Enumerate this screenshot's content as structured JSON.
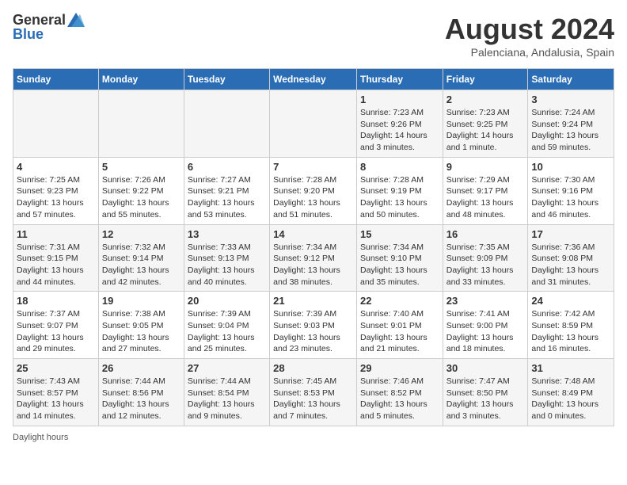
{
  "header": {
    "logo_general": "General",
    "logo_blue": "Blue",
    "month_year": "August 2024",
    "location": "Palenciana, Andalusia, Spain"
  },
  "weekdays": [
    "Sunday",
    "Monday",
    "Tuesday",
    "Wednesday",
    "Thursday",
    "Friday",
    "Saturday"
  ],
  "weeks": [
    [
      {
        "day": "",
        "info": ""
      },
      {
        "day": "",
        "info": ""
      },
      {
        "day": "",
        "info": ""
      },
      {
        "day": "",
        "info": ""
      },
      {
        "day": "1",
        "info": "Sunrise: 7:23 AM\nSunset: 9:26 PM\nDaylight: 14 hours\nand 3 minutes."
      },
      {
        "day": "2",
        "info": "Sunrise: 7:23 AM\nSunset: 9:25 PM\nDaylight: 14 hours\nand 1 minute."
      },
      {
        "day": "3",
        "info": "Sunrise: 7:24 AM\nSunset: 9:24 PM\nDaylight: 13 hours\nand 59 minutes."
      }
    ],
    [
      {
        "day": "4",
        "info": "Sunrise: 7:25 AM\nSunset: 9:23 PM\nDaylight: 13 hours\nand 57 minutes."
      },
      {
        "day": "5",
        "info": "Sunrise: 7:26 AM\nSunset: 9:22 PM\nDaylight: 13 hours\nand 55 minutes."
      },
      {
        "day": "6",
        "info": "Sunrise: 7:27 AM\nSunset: 9:21 PM\nDaylight: 13 hours\nand 53 minutes."
      },
      {
        "day": "7",
        "info": "Sunrise: 7:28 AM\nSunset: 9:20 PM\nDaylight: 13 hours\nand 51 minutes."
      },
      {
        "day": "8",
        "info": "Sunrise: 7:28 AM\nSunset: 9:19 PM\nDaylight: 13 hours\nand 50 minutes."
      },
      {
        "day": "9",
        "info": "Sunrise: 7:29 AM\nSunset: 9:17 PM\nDaylight: 13 hours\nand 48 minutes."
      },
      {
        "day": "10",
        "info": "Sunrise: 7:30 AM\nSunset: 9:16 PM\nDaylight: 13 hours\nand 46 minutes."
      }
    ],
    [
      {
        "day": "11",
        "info": "Sunrise: 7:31 AM\nSunset: 9:15 PM\nDaylight: 13 hours\nand 44 minutes."
      },
      {
        "day": "12",
        "info": "Sunrise: 7:32 AM\nSunset: 9:14 PM\nDaylight: 13 hours\nand 42 minutes."
      },
      {
        "day": "13",
        "info": "Sunrise: 7:33 AM\nSunset: 9:13 PM\nDaylight: 13 hours\nand 40 minutes."
      },
      {
        "day": "14",
        "info": "Sunrise: 7:34 AM\nSunset: 9:12 PM\nDaylight: 13 hours\nand 38 minutes."
      },
      {
        "day": "15",
        "info": "Sunrise: 7:34 AM\nSunset: 9:10 PM\nDaylight: 13 hours\nand 35 minutes."
      },
      {
        "day": "16",
        "info": "Sunrise: 7:35 AM\nSunset: 9:09 PM\nDaylight: 13 hours\nand 33 minutes."
      },
      {
        "day": "17",
        "info": "Sunrise: 7:36 AM\nSunset: 9:08 PM\nDaylight: 13 hours\nand 31 minutes."
      }
    ],
    [
      {
        "day": "18",
        "info": "Sunrise: 7:37 AM\nSunset: 9:07 PM\nDaylight: 13 hours\nand 29 minutes."
      },
      {
        "day": "19",
        "info": "Sunrise: 7:38 AM\nSunset: 9:05 PM\nDaylight: 13 hours\nand 27 minutes."
      },
      {
        "day": "20",
        "info": "Sunrise: 7:39 AM\nSunset: 9:04 PM\nDaylight: 13 hours\nand 25 minutes."
      },
      {
        "day": "21",
        "info": "Sunrise: 7:39 AM\nSunset: 9:03 PM\nDaylight: 13 hours\nand 23 minutes."
      },
      {
        "day": "22",
        "info": "Sunrise: 7:40 AM\nSunset: 9:01 PM\nDaylight: 13 hours\nand 21 minutes."
      },
      {
        "day": "23",
        "info": "Sunrise: 7:41 AM\nSunset: 9:00 PM\nDaylight: 13 hours\nand 18 minutes."
      },
      {
        "day": "24",
        "info": "Sunrise: 7:42 AM\nSunset: 8:59 PM\nDaylight: 13 hours\nand 16 minutes."
      }
    ],
    [
      {
        "day": "25",
        "info": "Sunrise: 7:43 AM\nSunset: 8:57 PM\nDaylight: 13 hours\nand 14 minutes."
      },
      {
        "day": "26",
        "info": "Sunrise: 7:44 AM\nSunset: 8:56 PM\nDaylight: 13 hours\nand 12 minutes."
      },
      {
        "day": "27",
        "info": "Sunrise: 7:44 AM\nSunset: 8:54 PM\nDaylight: 13 hours\nand 9 minutes."
      },
      {
        "day": "28",
        "info": "Sunrise: 7:45 AM\nSunset: 8:53 PM\nDaylight: 13 hours\nand 7 minutes."
      },
      {
        "day": "29",
        "info": "Sunrise: 7:46 AM\nSunset: 8:52 PM\nDaylight: 13 hours\nand 5 minutes."
      },
      {
        "day": "30",
        "info": "Sunrise: 7:47 AM\nSunset: 8:50 PM\nDaylight: 13 hours\nand 3 minutes."
      },
      {
        "day": "31",
        "info": "Sunrise: 7:48 AM\nSunset: 8:49 PM\nDaylight: 13 hours\nand 0 minutes."
      }
    ]
  ],
  "footer": {
    "note": "Daylight hours"
  }
}
